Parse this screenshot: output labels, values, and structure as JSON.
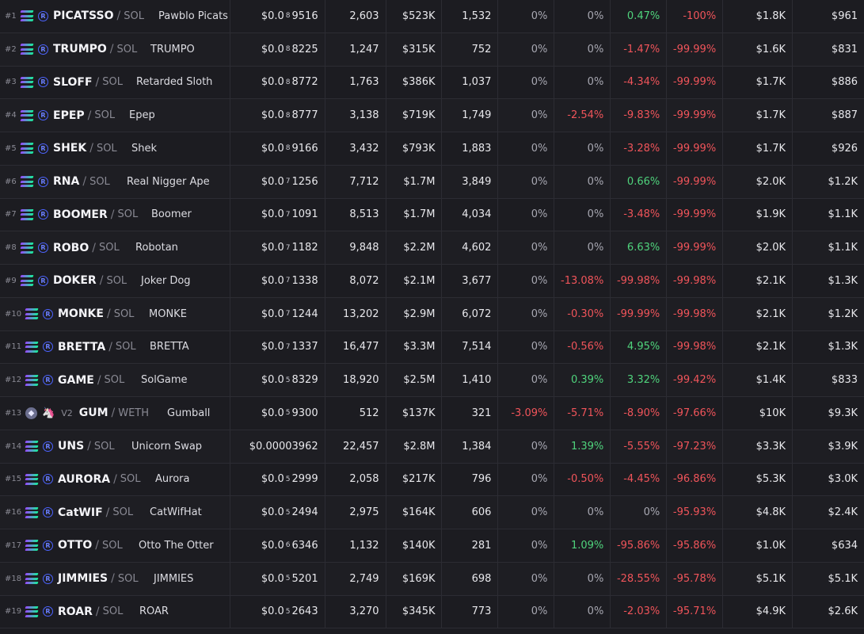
{
  "colors": {
    "positive": "#4fd37c",
    "negative": "#f0545a",
    "background": "#1c1c21"
  },
  "rows": [
    {
      "rank": "#1",
      "chain": "SOL",
      "dex": "raydium-icon",
      "symbol": "PICATSSO",
      "quote": "SOL",
      "name": "Pawblo Picats",
      "price_a": "$0.0",
      "price_zeros": "8",
      "price_b": "9516",
      "txns": "2,603",
      "volume": "$523K",
      "makers": "1,532",
      "p5m": "0%",
      "p1h": "0%",
      "p6h": "0.47%",
      "p24h": "-100%",
      "liquidity": "$1.8K",
      "mcap": "$961"
    },
    {
      "rank": "#2",
      "chain": "SOL",
      "dex": "raydium-icon",
      "symbol": "TRUMPO",
      "quote": "SOL",
      "name": "TRUMPO",
      "price_a": "$0.0",
      "price_zeros": "8",
      "price_b": "8225",
      "txns": "1,247",
      "volume": "$315K",
      "makers": "752",
      "p5m": "0%",
      "p1h": "0%",
      "p6h": "-1.47%",
      "p24h": "-99.99%",
      "liquidity": "$1.6K",
      "mcap": "$831"
    },
    {
      "rank": "#3",
      "chain": "SOL",
      "dex": "raydium-icon",
      "symbol": "SLOFF",
      "quote": "SOL",
      "name": "Retarded Sloth",
      "price_a": "$0.0",
      "price_zeros": "8",
      "price_b": "8772",
      "txns": "1,763",
      "volume": "$386K",
      "makers": "1,037",
      "p5m": "0%",
      "p1h": "0%",
      "p6h": "-4.34%",
      "p24h": "-99.99%",
      "liquidity": "$1.7K",
      "mcap": "$886"
    },
    {
      "rank": "#4",
      "chain": "SOL",
      "dex": "raydium-icon",
      "symbol": "EPEP",
      "quote": "SOL",
      "name": "Epep",
      "price_a": "$0.0",
      "price_zeros": "8",
      "price_b": "8777",
      "txns": "3,138",
      "volume": "$719K",
      "makers": "1,749",
      "p5m": "0%",
      "p1h": "-2.54%",
      "p6h": "-9.83%",
      "p24h": "-99.99%",
      "liquidity": "$1.7K",
      "mcap": "$887"
    },
    {
      "rank": "#5",
      "chain": "SOL",
      "dex": "raydium-icon",
      "symbol": "SHEK",
      "quote": "SOL",
      "name": "Shek",
      "price_a": "$0.0",
      "price_zeros": "8",
      "price_b": "9166",
      "txns": "3,432",
      "volume": "$793K",
      "makers": "1,883",
      "p5m": "0%",
      "p1h": "0%",
      "p6h": "-3.28%",
      "p24h": "-99.99%",
      "liquidity": "$1.7K",
      "mcap": "$926"
    },
    {
      "rank": "#6",
      "chain": "SOL",
      "dex": "raydium-icon",
      "symbol": "RNA",
      "quote": "SOL",
      "name": "Real Nigger Ape",
      "price_a": "$0.0",
      "price_zeros": "7",
      "price_b": "1256",
      "txns": "7,712",
      "volume": "$1.7M",
      "makers": "3,849",
      "p5m": "0%",
      "p1h": "0%",
      "p6h": "0.66%",
      "p24h": "-99.99%",
      "liquidity": "$2.0K",
      "mcap": "$1.2K"
    },
    {
      "rank": "#7",
      "chain": "SOL",
      "dex": "raydium-icon",
      "symbol": "BOOMER",
      "quote": "SOL",
      "name": "Boomer",
      "price_a": "$0.0",
      "price_zeros": "7",
      "price_b": "1091",
      "txns": "8,513",
      "volume": "$1.7M",
      "makers": "4,034",
      "p5m": "0%",
      "p1h": "0%",
      "p6h": "-3.48%",
      "p24h": "-99.99%",
      "liquidity": "$1.9K",
      "mcap": "$1.1K"
    },
    {
      "rank": "#8",
      "chain": "SOL",
      "dex": "raydium-icon",
      "symbol": "ROBO",
      "quote": "SOL",
      "name": "Robotan",
      "price_a": "$0.0",
      "price_zeros": "7",
      "price_b": "1182",
      "txns": "9,848",
      "volume": "$2.2M",
      "makers": "4,602",
      "p5m": "0%",
      "p1h": "0%",
      "p6h": "6.63%",
      "p24h": "-99.99%",
      "liquidity": "$2.0K",
      "mcap": "$1.1K"
    },
    {
      "rank": "#9",
      "chain": "SOL",
      "dex": "raydium-icon",
      "symbol": "DOKER",
      "quote": "SOL",
      "name": "Joker Dog",
      "price_a": "$0.0",
      "price_zeros": "7",
      "price_b": "1338",
      "txns": "8,072",
      "volume": "$2.1M",
      "makers": "3,677",
      "p5m": "0%",
      "p1h": "-13.08%",
      "p6h": "-99.98%",
      "p24h": "-99.98%",
      "liquidity": "$2.1K",
      "mcap": "$1.3K"
    },
    {
      "rank": "#10",
      "chain": "SOL",
      "dex": "raydium-icon",
      "symbol": "MONKE",
      "quote": "SOL",
      "name": "MONKE",
      "price_a": "$0.0",
      "price_zeros": "7",
      "price_b": "1244",
      "txns": "13,202",
      "volume": "$2.9M",
      "makers": "6,072",
      "p5m": "0%",
      "p1h": "-0.30%",
      "p6h": "-99.99%",
      "p24h": "-99.98%",
      "liquidity": "$2.1K",
      "mcap": "$1.2K"
    },
    {
      "rank": "#11",
      "chain": "SOL",
      "dex": "raydium-icon",
      "symbol": "BRETTA",
      "quote": "SOL",
      "name": "BRETTA",
      "price_a": "$0.0",
      "price_zeros": "7",
      "price_b": "1337",
      "txns": "16,477",
      "volume": "$3.3M",
      "makers": "7,514",
      "p5m": "0%",
      "p1h": "-0.56%",
      "p6h": "4.95%",
      "p24h": "-99.98%",
      "liquidity": "$2.1K",
      "mcap": "$1.3K"
    },
    {
      "rank": "#12",
      "chain": "SOL",
      "dex": "raydium-icon",
      "symbol": "GAME",
      "quote": "SOL",
      "name": "SolGame",
      "price_a": "$0.0",
      "price_zeros": "5",
      "price_b": "8329",
      "txns": "18,920",
      "volume": "$2.5M",
      "makers": "1,410",
      "p5m": "0%",
      "p1h": "0.39%",
      "p6h": "3.32%",
      "p24h": "-99.42%",
      "liquidity": "$1.4K",
      "mcap": "$833"
    },
    {
      "rank": "#13",
      "chain": "ETH",
      "dex": "uniswap-icon",
      "version": "V2",
      "symbol": "GUM",
      "quote": "WETH",
      "name": "Gumball",
      "price_a": "$0.0",
      "price_zeros": "5",
      "price_b": "9300",
      "txns": "512",
      "volume": "$137K",
      "makers": "321",
      "p5m": "-3.09%",
      "p1h": "-5.71%",
      "p6h": "-8.90%",
      "p24h": "-97.66%",
      "liquidity": "$10K",
      "mcap": "$9.3K"
    },
    {
      "rank": "#14",
      "chain": "SOL",
      "dex": "raydium-icon",
      "symbol": "UNS",
      "quote": "SOL",
      "name": "Unicorn Swap",
      "price_a": "$0.00003962",
      "price_zeros": "",
      "price_b": "",
      "txns": "22,457",
      "volume": "$2.8M",
      "makers": "1,384",
      "p5m": "0%",
      "p1h": "1.39%",
      "p6h": "-5.55%",
      "p24h": "-97.23%",
      "liquidity": "$3.3K",
      "mcap": "$3.9K"
    },
    {
      "rank": "#15",
      "chain": "SOL",
      "dex": "raydium-icon",
      "symbol": "AURORA",
      "quote": "SOL",
      "name": "Aurora",
      "price_a": "$0.0",
      "price_zeros": "5",
      "price_b": "2999",
      "txns": "2,058",
      "volume": "$217K",
      "makers": "796",
      "p5m": "0%",
      "p1h": "-0.50%",
      "p6h": "-4.45%",
      "p24h": "-96.86%",
      "liquidity": "$5.3K",
      "mcap": "$3.0K"
    },
    {
      "rank": "#16",
      "chain": "SOL",
      "dex": "raydium-icon",
      "symbol": "CatWIF",
      "quote": "SOL",
      "name": "CatWifHat",
      "price_a": "$0.0",
      "price_zeros": "5",
      "price_b": "2494",
      "txns": "2,975",
      "volume": "$164K",
      "makers": "606",
      "p5m": "0%",
      "p1h": "0%",
      "p6h": "0%",
      "p24h": "-95.93%",
      "liquidity": "$4.8K",
      "mcap": "$2.4K"
    },
    {
      "rank": "#17",
      "chain": "SOL",
      "dex": "raydium-icon",
      "symbol": "OTTO",
      "quote": "SOL",
      "name": "Otto The Otter",
      "price_a": "$0.0",
      "price_zeros": "6",
      "price_b": "6346",
      "txns": "1,132",
      "volume": "$140K",
      "makers": "281",
      "p5m": "0%",
      "p1h": "1.09%",
      "p6h": "-95.86%",
      "p24h": "-95.86%",
      "liquidity": "$1.0K",
      "mcap": "$634"
    },
    {
      "rank": "#18",
      "chain": "SOL",
      "dex": "raydium-icon",
      "symbol": "JIMMIES",
      "quote": "SOL",
      "name": "JIMMIES",
      "price_a": "$0.0",
      "price_zeros": "5",
      "price_b": "5201",
      "txns": "2,749",
      "volume": "$169K",
      "makers": "698",
      "p5m": "0%",
      "p1h": "0%",
      "p6h": "-28.55%",
      "p24h": "-95.78%",
      "liquidity": "$5.1K",
      "mcap": "$5.1K"
    },
    {
      "rank": "#19",
      "chain": "SOL",
      "dex": "raydium-icon",
      "symbol": "ROAR",
      "quote": "SOL",
      "name": "ROAR",
      "price_a": "$0.0",
      "price_zeros": "5",
      "price_b": "2643",
      "txns": "3,270",
      "volume": "$345K",
      "makers": "773",
      "p5m": "0%",
      "p1h": "0%",
      "p6h": "-2.03%",
      "p24h": "-95.71%",
      "liquidity": "$4.9K",
      "mcap": "$2.6K"
    }
  ]
}
